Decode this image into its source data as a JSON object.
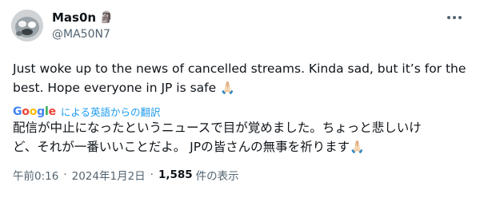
{
  "author": {
    "display_name": "Mas0n",
    "name_emoji": "🗿",
    "handle": "@MA50N7"
  },
  "post": {
    "text_line1": "Just woke up to the news of cancelled streams. Kinda sad, but it’s for the",
    "text_line2": "best. Hope everyone in JP is safe",
    "emoji": "🙏🏻"
  },
  "translation": {
    "provider": "Google",
    "label": "による英語からの翻訳",
    "line1": "配信が中止になったというニュースで目が覚めました。ちょっと悲しいけ",
    "line2": "ど、それが一番いいことだよ。 JPの皆さんの無事を祈ります",
    "emoji": "🙏🏻"
  },
  "meta": {
    "time": "午前0:16",
    "separator": "·",
    "date": "2024年1月2日",
    "views_count": "1,585",
    "views_label": "件の表示"
  },
  "colors": {
    "text": "#0f1419",
    "secondary": "#536471",
    "link": "#1d9bf0"
  }
}
